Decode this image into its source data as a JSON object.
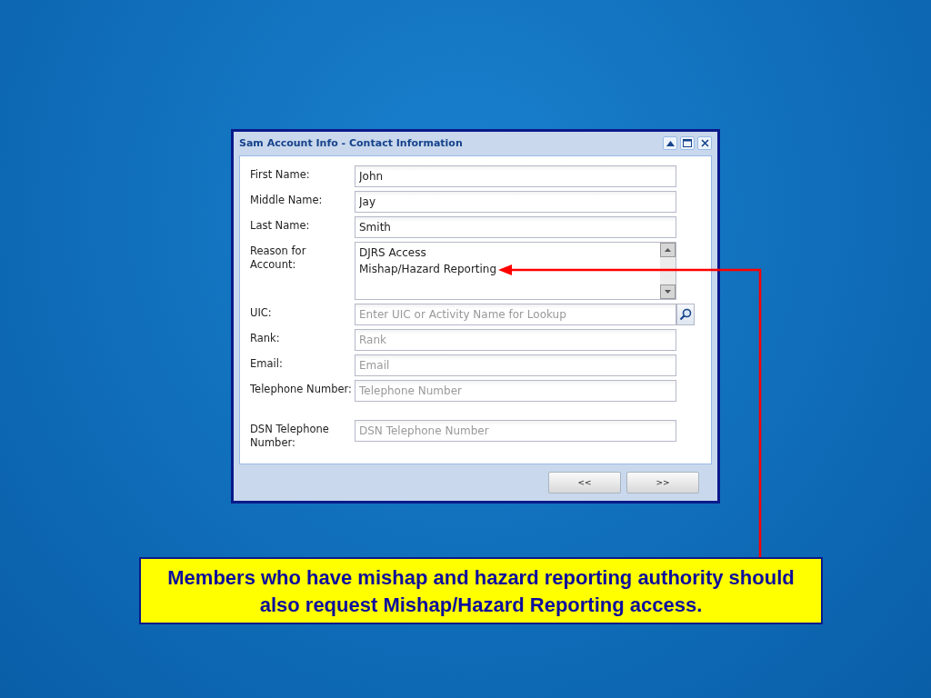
{
  "window": {
    "title": "Sam Account Info - Contact Information"
  },
  "fields": [
    {
      "kind": "text",
      "label": "First Name:",
      "value": "John"
    },
    {
      "kind": "text",
      "label": "Middle Name:",
      "value": "Jay"
    },
    {
      "kind": "text",
      "label": "Last Name:",
      "value": "Smith"
    },
    {
      "kind": "textarea",
      "label": "Reason for Account:",
      "lines": [
        "DJRS Access",
        "Mishap/Hazard Reporting"
      ]
    },
    {
      "kind": "lookup",
      "label": "UIC:",
      "placeholder": "Enter UIC or Activity Name for Lookup"
    },
    {
      "kind": "text",
      "label": "Rank:",
      "placeholder": "Rank"
    },
    {
      "kind": "text",
      "label": "Email:",
      "placeholder": "Email"
    },
    {
      "kind": "text",
      "label": "Telephone Number:",
      "placeholder": "Telephone Number"
    },
    {
      "kind": "text",
      "label": "DSN Telephone Number:",
      "placeholder": "DSN Telephone Number"
    }
  ],
  "buttons": [
    "<<",
    ">>"
  ],
  "callout": {
    "text": "Members who have mishap and hazard reporting authority should also request Mishap/Hazard Reporting access."
  }
}
